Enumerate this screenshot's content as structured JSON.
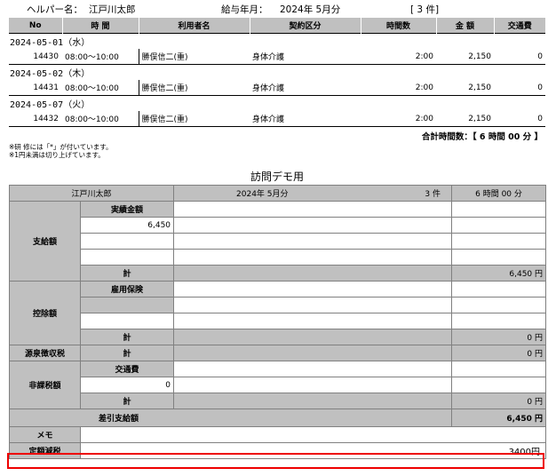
{
  "header": {
    "helper_label": "ヘルパー名：",
    "helper_name": "江戸川太郎",
    "pay_label": "給与年月：",
    "pay_month": "2024年 5月分",
    "count": "[ 3 件]"
  },
  "detail": {
    "columns": [
      "No",
      "時 間",
      "利用者名",
      "契約区分",
      "時間数",
      "金 額",
      "交通費"
    ],
    "groups": [
      {
        "date": "2024-05-01（水）",
        "no": "14430",
        "time": "08:00～10:00",
        "user": "勝俣信二(重)",
        "contract": "身体介護",
        "hours": "2:00",
        "amount": "2,150",
        "transport": "0"
      },
      {
        "date": "2024-05-02（木）",
        "no": "14431",
        "time": "08:00～10:00",
        "user": "勝俣信二(重)",
        "contract": "身体介護",
        "hours": "2:00",
        "amount": "2,150",
        "transport": "0"
      },
      {
        "date": "2024-05-07（火）",
        "no": "14432",
        "time": "08:00～10:00",
        "user": "勝俣信二(重)",
        "contract": "身体介護",
        "hours": "2:00",
        "amount": "2,150",
        "transport": "0"
      }
    ],
    "total_hours": "合計時間数：【 6 時間 00 分 】"
  },
  "notes": [
    "※研 修には「*」が付いています。",
    "※1円未満は切り上げています。"
  ],
  "summary": {
    "title": "訪問デモ用",
    "name": "江戸川太郎",
    "month": "2024年 5月分",
    "count": "3 件",
    "hours": "6 時間 00 分",
    "pay_label": "支給額",
    "actual_label": "実績金額",
    "actual_value": "6,450",
    "sum_label": "計",
    "pay_total": "6,450 円",
    "deduct_label": "控除額",
    "insurance_label": "雇用保険",
    "deduct_total": "0 円",
    "withholding_label": "源泉徴収税",
    "withholding_total": "0 円",
    "nontax_label": "非課税額",
    "transport_label": "交通費",
    "transport_value": "0",
    "nontax_total": "0 円",
    "net_label": "差引支給額",
    "net_value": "6,450 円",
    "memo_label": "メモ",
    "fixed_tax_label": "定額減税",
    "fixed_tax_value": "3400円"
  }
}
